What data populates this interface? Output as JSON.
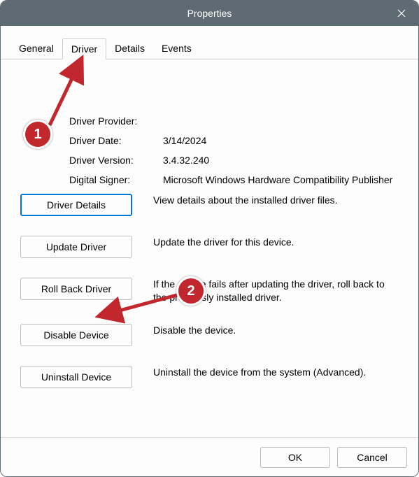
{
  "window": {
    "title": "Properties"
  },
  "tabs": {
    "general": "General",
    "driver": "Driver",
    "details": "Details",
    "events": "Events"
  },
  "info": {
    "provider_label": "Driver Provider:",
    "provider_value": "",
    "date_label": "Driver Date:",
    "date_value": "3/14/2024",
    "version_label": "Driver Version:",
    "version_value": "3.4.32.240",
    "signer_label": "Digital Signer:",
    "signer_value": "Microsoft Windows Hardware Compatibility Publisher"
  },
  "buttons": {
    "details": {
      "label": "Driver Details",
      "desc": "View details about the installed driver files."
    },
    "update": {
      "label": "Update Driver",
      "desc": "Update the driver for this device."
    },
    "rollback": {
      "label": "Roll Back Driver",
      "desc": "If the device fails after updating the driver, roll back to the previously installed driver."
    },
    "disable": {
      "label": "Disable Device",
      "desc": "Disable the device."
    },
    "uninstall": {
      "label": "Uninstall Device",
      "desc": "Uninstall the device from the system (Advanced)."
    }
  },
  "footer": {
    "ok": "OK",
    "cancel": "Cancel"
  },
  "annotations": {
    "badge1": "1",
    "badge2": "2"
  }
}
